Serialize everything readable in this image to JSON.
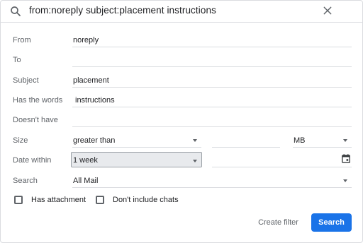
{
  "search": {
    "query": "from:noreply subject:placement instructions"
  },
  "form": {
    "from_label": "From",
    "from_value": "noreply",
    "to_label": "To",
    "to_value": "",
    "subject_label": "Subject",
    "subject_value": "placement",
    "has_words_label": "Has the words",
    "has_words_value": "instructions",
    "doesnt_have_label": "Doesn't have",
    "doesnt_have_value": "",
    "size_label": "Size",
    "size_operator": "greater than",
    "size_value": "",
    "size_unit": "MB",
    "date_within_label": "Date within",
    "date_within_value": "1 week",
    "date_value": "",
    "search_label": "Search",
    "search_scope": "All Mail",
    "has_attachment_label": "Has attachment",
    "dont_include_chats_label": "Don't include chats"
  },
  "actions": {
    "create_filter": "Create filter",
    "search": "Search"
  },
  "colors": {
    "primary": "#1a73e8",
    "border": "#dadce0",
    "label": "#5f6368"
  },
  "icons": [
    "search-icon",
    "close-icon",
    "calendar-icon",
    "caret-down-icon"
  ]
}
